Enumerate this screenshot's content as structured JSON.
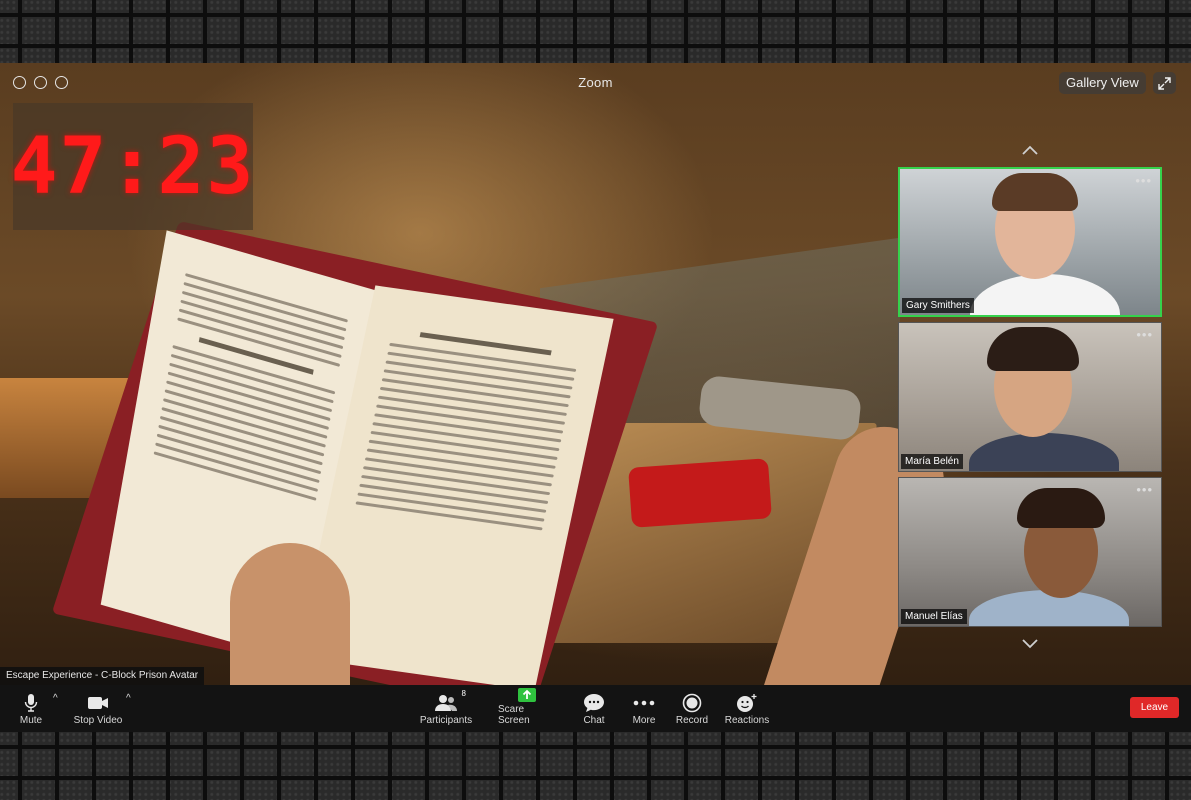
{
  "window": {
    "title": "Zoom",
    "view_button": "Gallery View"
  },
  "timer": {
    "value": "47:23",
    "color": "#ff1a1a"
  },
  "participants_tiles": [
    {
      "name": "Gary Smithers",
      "active": true
    },
    {
      "name": "María Belén",
      "active": false
    },
    {
      "name": "Manuel Elías",
      "active": false
    }
  ],
  "meeting_label": "Escape Experience - C-Block Prison Avatar",
  "toolbar": {
    "mute": "Mute",
    "stop_video": "Stop Video",
    "participants": "Participants",
    "participants_count": "8",
    "scare_screen": "Scare Screen",
    "chat": "Chat",
    "more": "More",
    "record": "Record",
    "reactions": "Reactions",
    "leave": "Leave"
  },
  "colors": {
    "active_speaker": "#35d24c",
    "scare_screen_icon": "#2fc23f",
    "leave": "#e02828"
  },
  "icons": {
    "window_controls": "circle-outline-icon",
    "fullscreen": "expand-arrows-icon",
    "tile_more": "ellipsis-icon",
    "mute": "microphone-icon",
    "stop_video": "video-camera-icon",
    "participants": "people-icon",
    "scare_screen": "share-screen-up-arrow-icon",
    "chat": "speech-bubble-icon",
    "more": "horizontal-dots-icon",
    "record": "record-circle-icon",
    "reactions": "smiley-plus-icon"
  }
}
